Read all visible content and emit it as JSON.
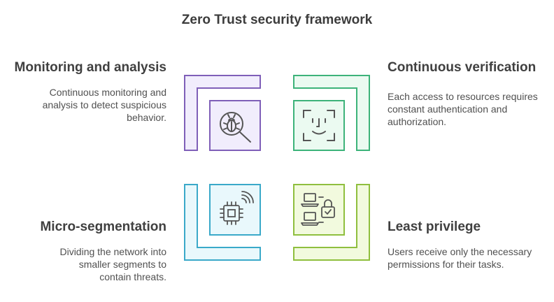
{
  "title": "Zero Trust security framework",
  "quadrants": [
    {
      "heading": "Monitoring and analysis",
      "description": "Continuous monitoring and analysis to detect suspicious behavior.",
      "icon": "bug-magnifier-icon",
      "color": "#7f5fb8",
      "fill": "#f1edfc"
    },
    {
      "heading": "Continuous verification",
      "description": "Each access to resources requires constant authentication and authorization.",
      "icon": "face-scan-icon",
      "color": "#3db37a",
      "fill": "#ebfaf1"
    },
    {
      "heading": "Micro-segmentation",
      "description": "Dividing the network into smaller segments to contain threats.",
      "icon": "wireless-chip-icon",
      "color": "#3aa9c9",
      "fill": "#e9f8fc"
    },
    {
      "heading": "Least privilege",
      "description": "Users receive only the necessary permissions for their tasks.",
      "icon": "laptops-lock-icon",
      "color": "#8fbf3e",
      "fill": "#f2fade"
    }
  ]
}
